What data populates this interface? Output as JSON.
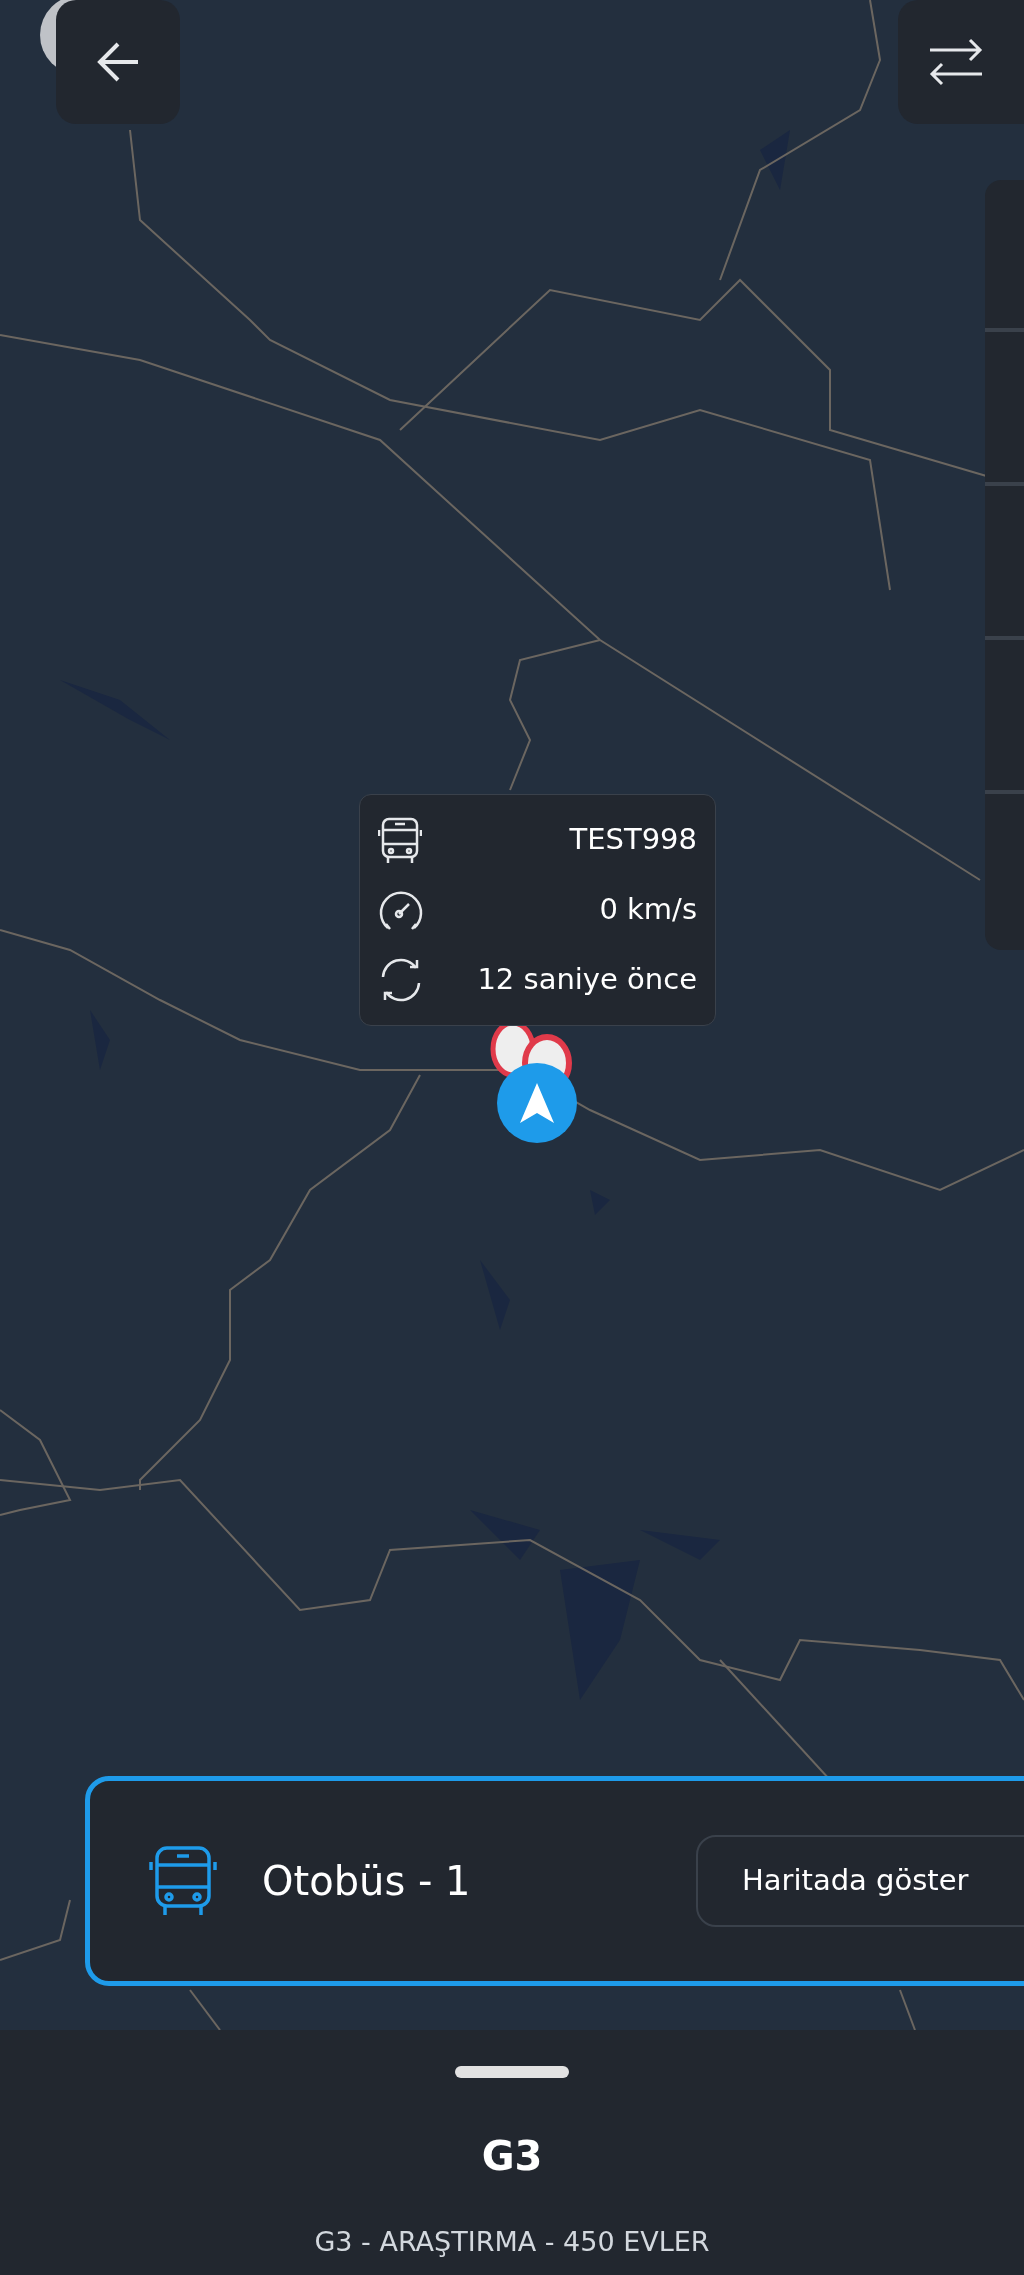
{
  "popup": {
    "rows": [
      {
        "kind": "bus",
        "text": "TEST998"
      },
      {
        "kind": "speed",
        "text": "0 km/s"
      },
      {
        "kind": "refresh",
        "text": "12 saniye önce"
      }
    ]
  },
  "vehicle_card": {
    "name": "Otobüs - 1",
    "button": "Haritada göster",
    "selected": true
  },
  "bottom_sheet": {
    "title": "G3",
    "subtitle": "G3 - ARAŞTIRMA - 450 EVLER"
  }
}
